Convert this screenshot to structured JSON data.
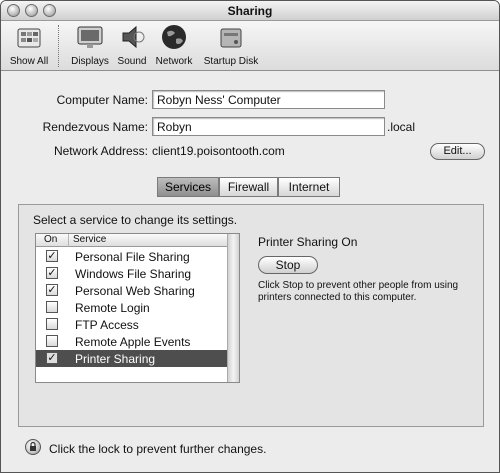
{
  "window": {
    "title": "Sharing"
  },
  "toolbar": {
    "items": [
      {
        "label": "Show All",
        "icon": "show-all-icon"
      },
      {
        "label": "Displays",
        "icon": "displays-icon"
      },
      {
        "label": "Sound",
        "icon": "sound-icon"
      },
      {
        "label": "Network",
        "icon": "network-icon"
      },
      {
        "label": "Startup Disk",
        "icon": "startup-disk-icon"
      }
    ]
  },
  "form": {
    "computer_name_label": "Computer Name:",
    "computer_name_value": "Robyn Ness' Computer",
    "rendezvous_label": "Rendezvous Name:",
    "rendezvous_value": "Robyn",
    "rendezvous_suffix": ".local",
    "address_label": "Network Address:",
    "address_value": "client19.poisontooth.com",
    "edit_button": "Edit..."
  },
  "tabs": [
    {
      "label": "Services",
      "active": true
    },
    {
      "label": "Firewall",
      "active": false
    },
    {
      "label": "Internet",
      "active": false
    }
  ],
  "services": {
    "hint": "Select a service to change its settings.",
    "col_on": "On",
    "col_service": "Service",
    "rows": [
      {
        "label": "Personal File Sharing",
        "checked": true,
        "selected": false
      },
      {
        "label": "Windows File Sharing",
        "checked": true,
        "selected": false
      },
      {
        "label": "Personal Web Sharing",
        "checked": true,
        "selected": false
      },
      {
        "label": "Remote Login",
        "checked": false,
        "selected": false
      },
      {
        "label": "FTP Access",
        "checked": false,
        "selected": false
      },
      {
        "label": "Remote Apple Events",
        "checked": false,
        "selected": false
      },
      {
        "label": "Printer Sharing",
        "checked": true,
        "selected": true
      }
    ],
    "status_title": "Printer Sharing On",
    "stop_button": "Stop",
    "description": "Click Stop to prevent other people from using printers connected to this computer."
  },
  "footer": {
    "lock_text": "Click the lock to prevent further changes."
  },
  "colors": {
    "selection": "#4e4e4e",
    "tab_active": "#9a9a9a"
  }
}
